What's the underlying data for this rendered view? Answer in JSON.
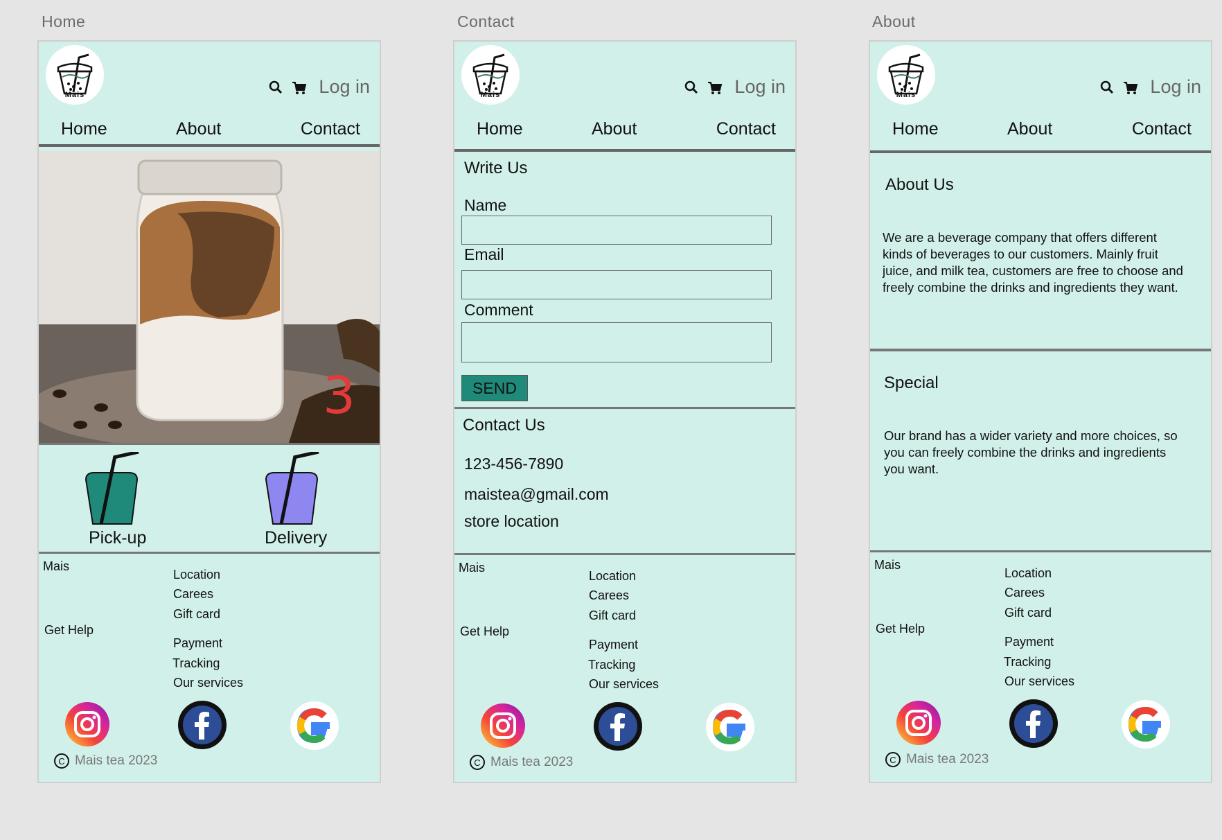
{
  "frames": [
    {
      "title": "Home"
    },
    {
      "title": "Contact"
    },
    {
      "title": "About"
    }
  ],
  "header": {
    "logo_text": "Mais",
    "login": "Log in",
    "icons": [
      "search-icon",
      "cart-icon"
    ]
  },
  "nav": {
    "home": "Home",
    "about": "About",
    "contact": "Contact"
  },
  "home": {
    "pickup": "Pick-up",
    "delivery": "Delivery",
    "annotation": "3"
  },
  "contact": {
    "write_title": "Write Us",
    "name_label": "Name",
    "email_label": "Email",
    "comment_label": "Comment",
    "send": "SEND",
    "contact_title": "Contact Us",
    "phone": "123-456-7890",
    "email": "maistea@gmail.com",
    "location": "store location"
  },
  "about": {
    "about_title": "About Us",
    "about_text": "We are a beverage company that offers different kinds of beverages to our customers. Mainly fruit juice, and milk tea, customers are free to choose and freely combine the drinks and ingredients they want.",
    "special_title": "Special",
    "special_text": "Our brand has a wider variety and more choices, so you can freely combine the drinks and ingredients you want."
  },
  "footer": {
    "brand": "Mais",
    "get_help": "Get Help",
    "col1": [
      "Location",
      "Carees",
      "Gift card"
    ],
    "col2": [
      "Payment",
      "Tracking",
      "Our services"
    ],
    "copyright_symbol": "C",
    "copyright": "Mais tea 2023",
    "socials": [
      "instagram-icon",
      "facebook-icon",
      "google-icon"
    ]
  },
  "colors": {
    "background": "#d2f0ea",
    "pickup_cup": "#1f8a7a",
    "delivery_cup": "#8f87f0",
    "send_button": "#1f8a7a"
  }
}
